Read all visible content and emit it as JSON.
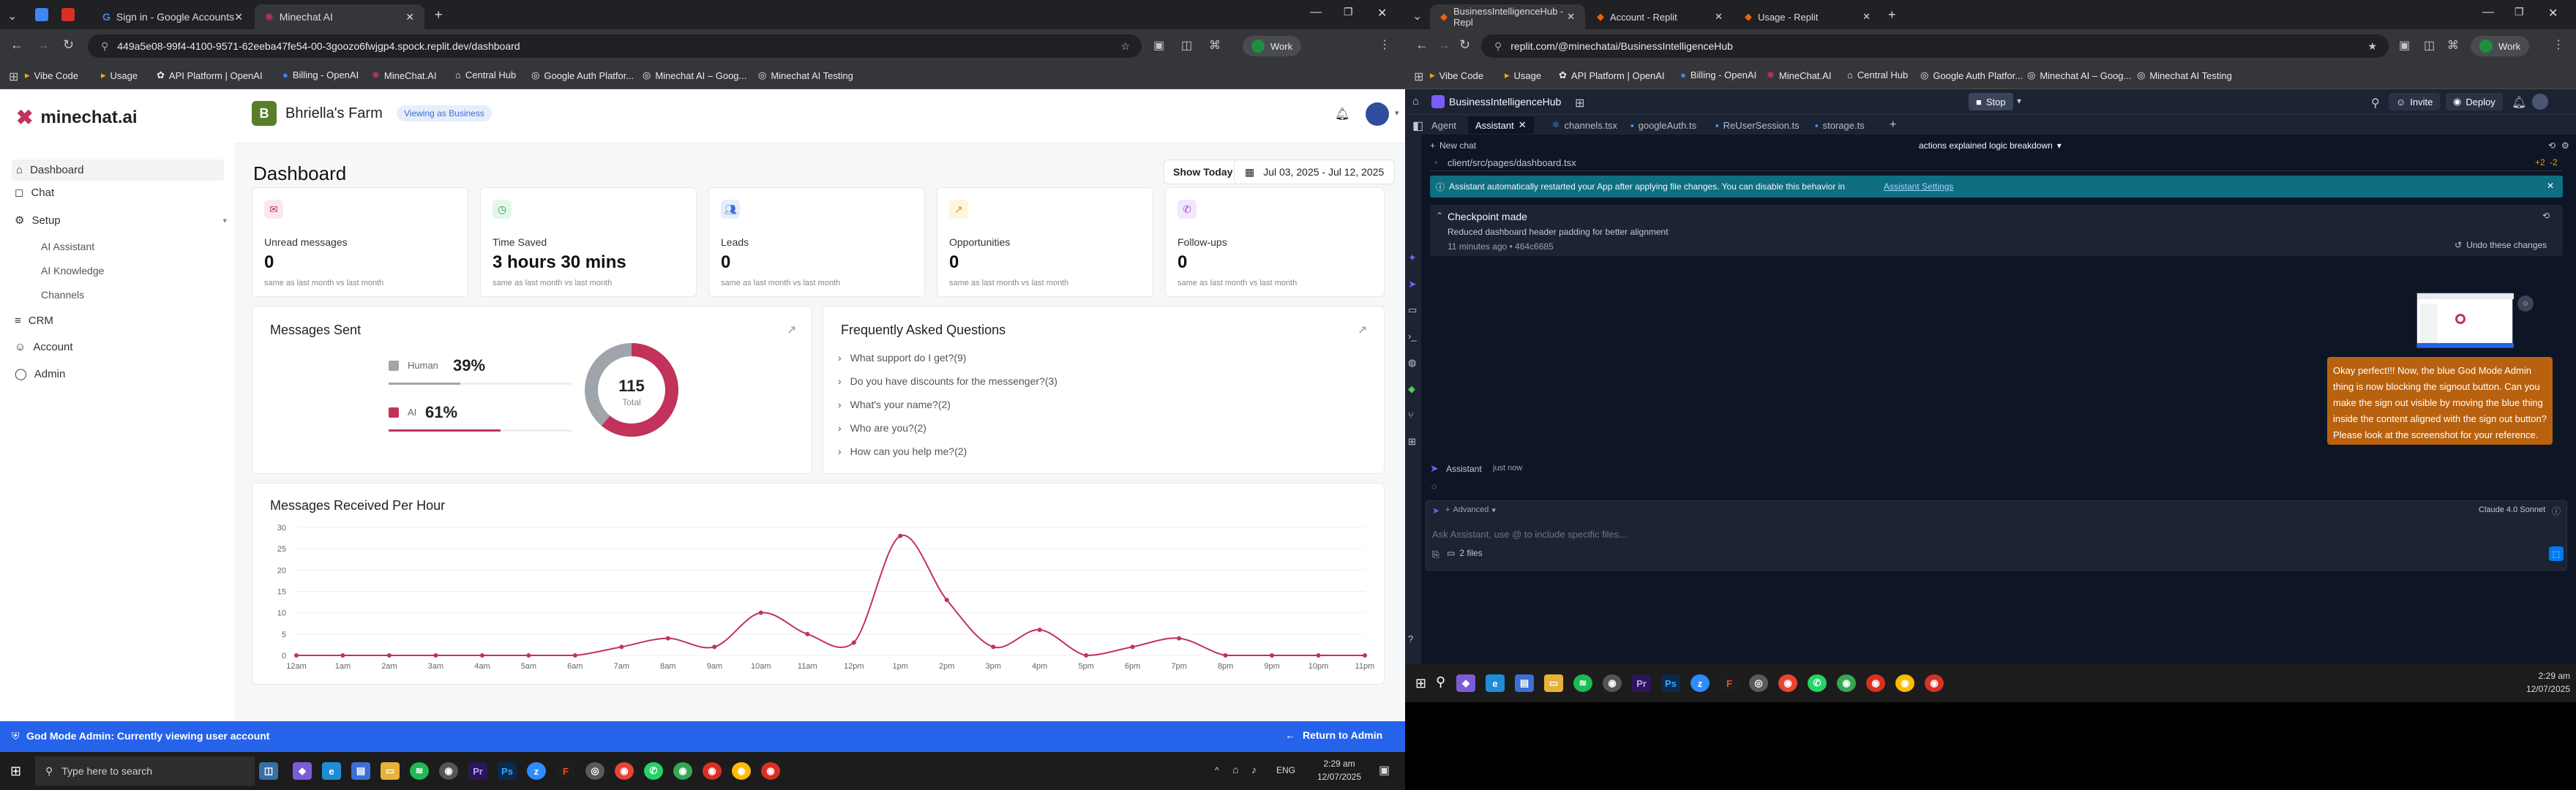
{
  "left_browser": {
    "tabs": [
      {
        "label": "Sign in - Google Accounts"
      },
      {
        "label": "Minechat AI"
      }
    ],
    "url": "449a5e08-99f4-4100-9571-62eeba47fe54-00-3goozo6fwjgp4.spock.replit.dev/dashboard",
    "profile": "Work",
    "bookmarks": [
      "Vibe Code",
      "Usage",
      "API Platform | OpenAI",
      "Billing - OpenAI",
      "MineChat.AI",
      "Central Hub",
      "Google Auth Platfor...",
      "Minechat AI – Goog...",
      "Minechat AI Testing"
    ]
  },
  "app": {
    "brand": "minechat.ai",
    "business_name": "Bhriella's Farm",
    "viewing_badge": "Viewing as Business",
    "nav": {
      "dashboard": "Dashboard",
      "chat": "Chat",
      "setup": "Setup",
      "ai_assistant": "AI Assistant",
      "ai_knowledge": "AI Knowledge",
      "channels": "Channels",
      "crm": "CRM",
      "account": "Account",
      "admin": "Admin"
    },
    "page_title": "Dashboard",
    "show_today": "Show Today",
    "date_range": "Jul 03, 2025 - Jul 12, 2025",
    "kpis": [
      {
        "label": "Unread messages",
        "value": "0",
        "sub": "same as last month vs last month",
        "icon": "mail-icon"
      },
      {
        "label": "Time Saved",
        "value": "3 hours 30 mins",
        "sub": "same as last month vs last month",
        "icon": "clock-icon"
      },
      {
        "label": "Leads",
        "value": "0",
        "sub": "same as last month vs last month",
        "icon": "users-icon"
      },
      {
        "label": "Opportunities",
        "value": "0",
        "sub": "same as last month vs last month",
        "icon": "trend-icon"
      },
      {
        "label": "Follow-ups",
        "value": "0",
        "sub": "same as last month vs last month",
        "icon": "phone-icon"
      }
    ],
    "messages_sent": {
      "title": "Messages Sent",
      "human_label": "Human",
      "human_pct": "39%",
      "ai_label": "AI",
      "ai_pct": "61%",
      "total": "115",
      "total_label": "Total",
      "human_fraction": 0.39,
      "ai_fraction": 0.61
    },
    "faq": {
      "title": "Frequently Asked Questions",
      "items": [
        "What support do I get?(9)",
        "Do you have discounts for the messenger?(3)",
        "What's your name?(2)",
        "Who are you?(2)",
        "How can you help me?(2)"
      ]
    },
    "god_mode": {
      "text": "God Mode Admin: Currently viewing user account",
      "return": "Return to Admin"
    }
  },
  "chart_data": {
    "type": "line",
    "title": "Messages Received Per Hour",
    "x": [
      "12am",
      "1am",
      "2am",
      "3am",
      "4am",
      "5am",
      "6am",
      "7am",
      "8am",
      "9am",
      "10am",
      "11am",
      "12pm",
      "1pm",
      "2pm",
      "3pm",
      "4pm",
      "5pm",
      "6pm",
      "7pm",
      "8pm",
      "9pm",
      "10pm",
      "11pm"
    ],
    "values": [
      0,
      0,
      0,
      0,
      0,
      0,
      0,
      2,
      4,
      2,
      10,
      5,
      3,
      28,
      13,
      2,
      6,
      0,
      2,
      4,
      0,
      0,
      0,
      0
    ],
    "yticks": [
      "0",
      "5",
      "10",
      "15",
      "20",
      "25",
      "30"
    ],
    "ylim": [
      0,
      30
    ],
    "color": "#c2325a"
  },
  "right_browser": {
    "tabs": [
      {
        "label": "BusinessIntelligenceHub - Repl"
      },
      {
        "label": "Account - Replit"
      },
      {
        "label": "Usage - Replit"
      }
    ],
    "url": "replit.com/@minechatai/BusinessIntelligenceHub",
    "profile": "Work",
    "bookmarks": [
      "Vibe Code",
      "Usage",
      "API Platform | OpenAI",
      "Billing - OpenAI",
      "MineChat.AI",
      "Central Hub",
      "Google Auth Platfor...",
      "Minechat AI – Goog...",
      "Minechat AI Testing"
    ]
  },
  "replit": {
    "project": "BusinessIntelligenceHub",
    "stop": "Stop",
    "invite": "Invite",
    "deploy": "Deploy",
    "tabs": [
      "Agent",
      "Assistant",
      "channels.tsx",
      "googleAuth.ts",
      "ReUserSession.ts",
      "storage.ts"
    ],
    "new_chat": "New chat",
    "chat_title": "actions explained logic breakdown",
    "file_path": "client/src/pages/dashboard.tsx",
    "diff_add": "+2",
    "diff_del": "-2",
    "banner_text": "Assistant automatically restarted your App after applying file changes. You can disable this behavior in",
    "banner_link": "Assistant Settings",
    "checkpoint_title": "Checkpoint made",
    "checkpoint_desc": "Reduced dashboard header padding for better alignment",
    "checkpoint_meta": "11 minutes ago  •  464c6685",
    "undo": "Undo these changes",
    "user_message": "Okay perfect!!! Now, the blue God Mode Admin thing is now blocking the signout button. Can you make the sign out visible by moving the blue thing inside the content aligned with the sign out button? Please look at the screenshot for your reference.",
    "assistant_label": "Assistant",
    "assistant_time": "just now",
    "advanced": "Advanced",
    "model": "Claude 4.0 Sonnet",
    "input_placeholder": "Ask Assistant, use @ to include specific files...",
    "files": "2 files"
  },
  "taskbar": {
    "search_placeholder": "Type here to search",
    "lang": "ENG",
    "time_left": "2:29 am",
    "date_left": "12/07/2025",
    "time_right": "2:29 am",
    "date_right": "12/07/2025"
  }
}
